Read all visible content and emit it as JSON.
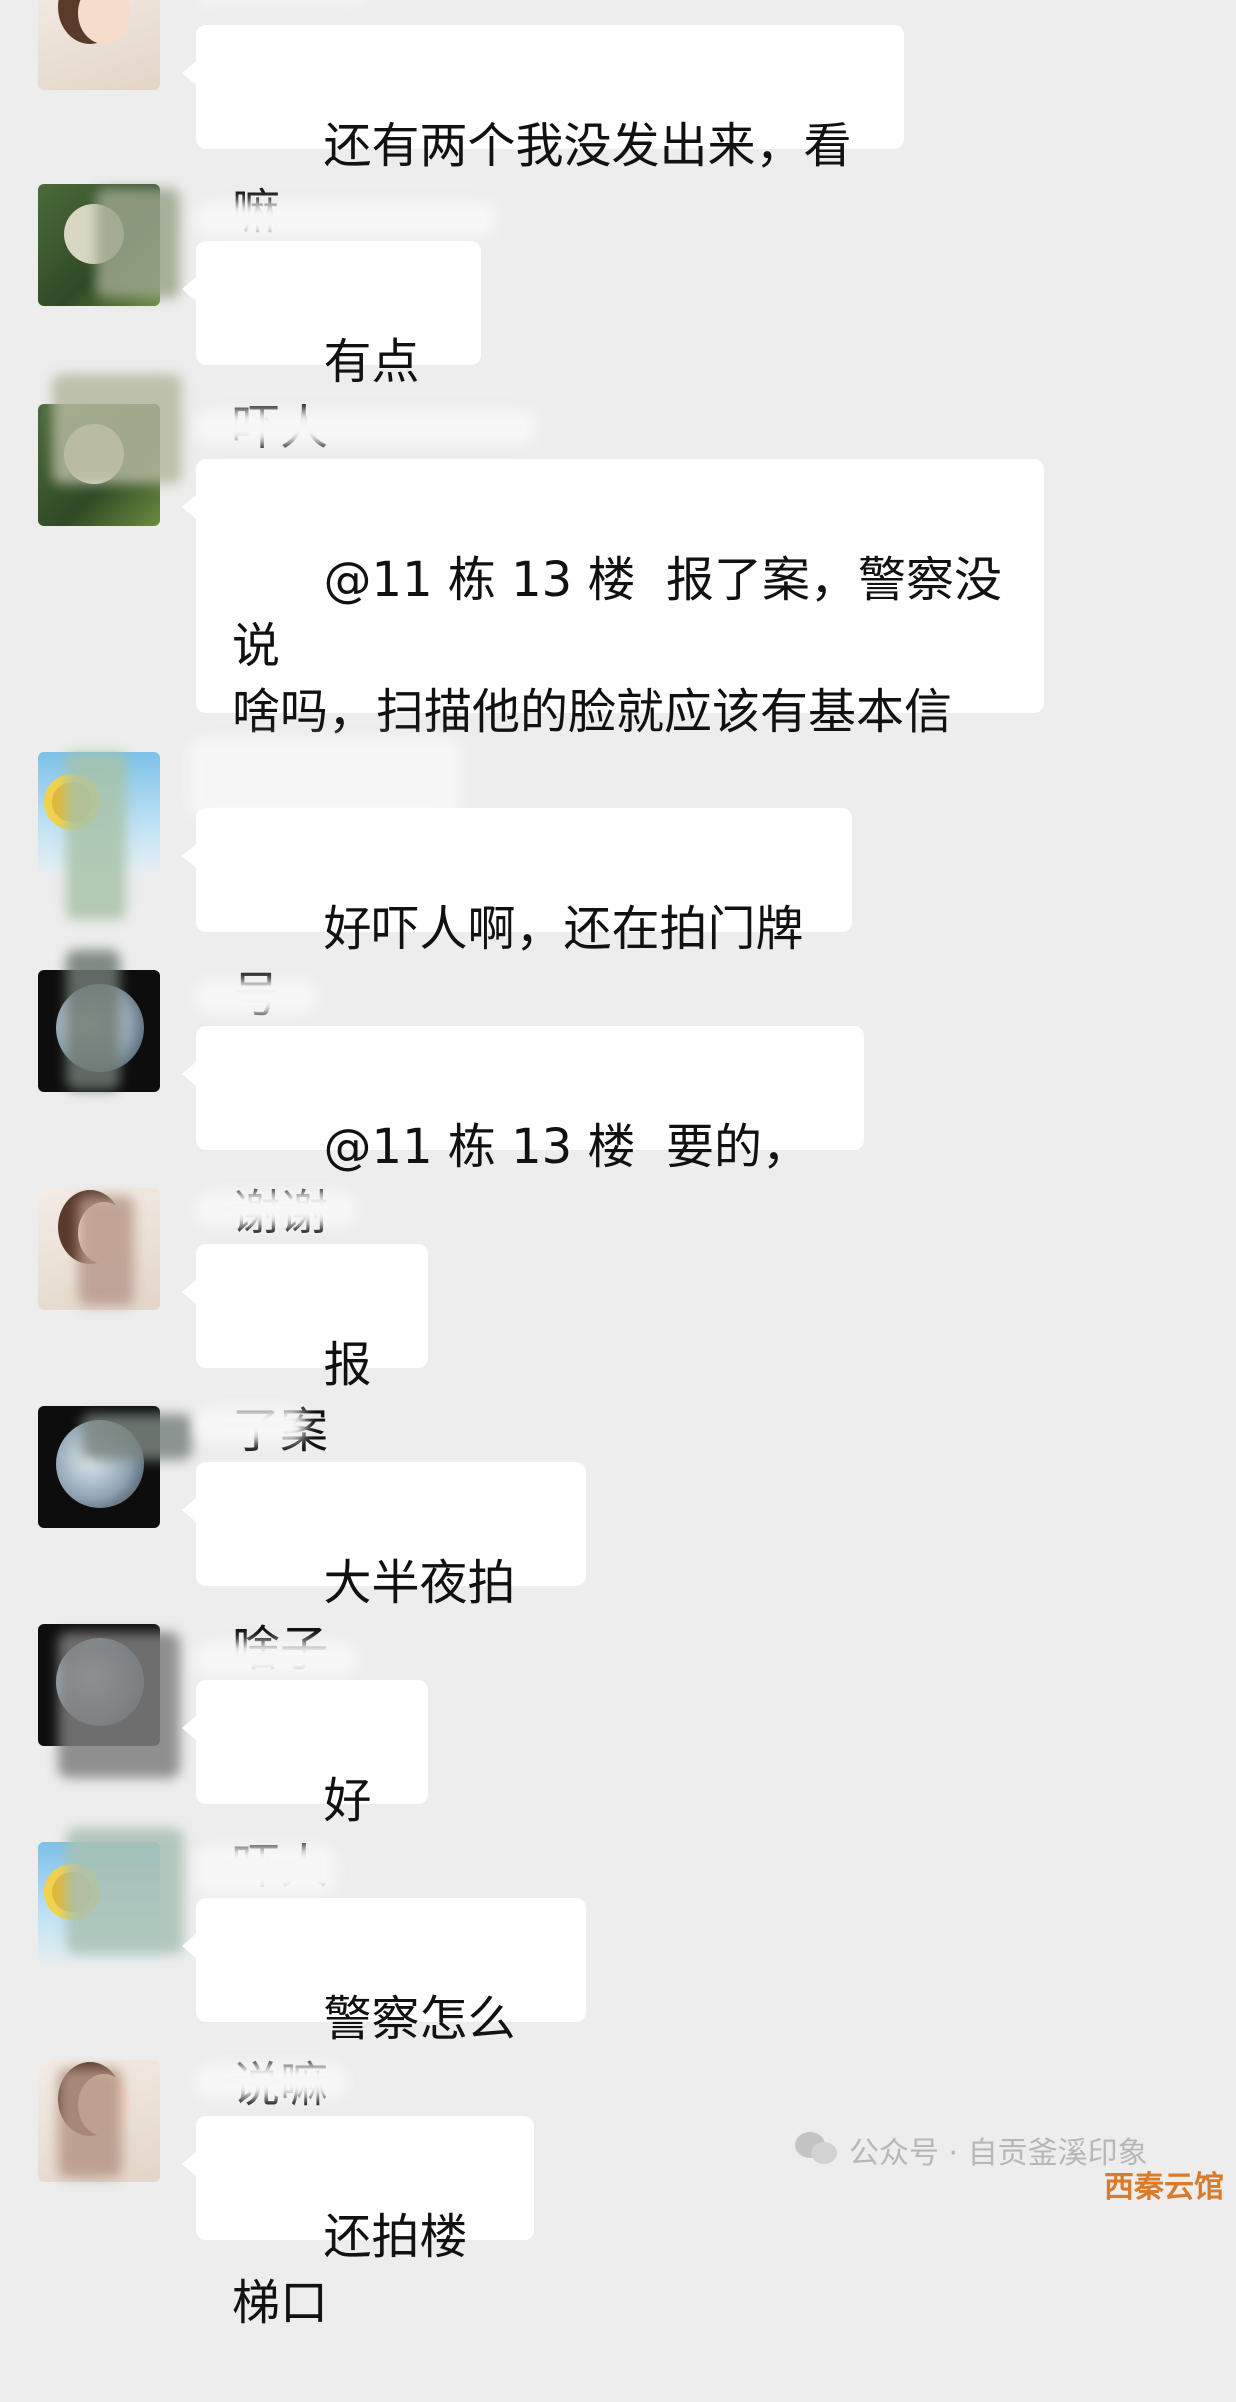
{
  "messages": [
    {
      "avatar": "girl-avatar",
      "text": "还有两个我没发出来，看嘛"
    },
    {
      "avatar": "plant-avatar",
      "text": "有点吓人"
    },
    {
      "avatar": "plant-avatar",
      "text": "@11 栋 13 楼  报了案，警察没说\n啥吗，扫描他的脸就应该有基本信\n息"
    },
    {
      "avatar": "sky-avatar",
      "text": "好吓人啊，还在拍门牌号"
    },
    {
      "avatar": "dark-avatar",
      "text": "@11 栋 13 楼  要的，谢谢"
    },
    {
      "avatar": "girl-avatar",
      "text": "报了案"
    },
    {
      "avatar": "dark-avatar",
      "text": "大半夜拍啥子"
    },
    {
      "avatar": "dark-avatar",
      "text": "好吓人"
    },
    {
      "avatar": "sky-avatar",
      "text": "警察怎么说嘛"
    },
    {
      "avatar": "girl-avatar",
      "text": "还拍楼梯口"
    }
  ],
  "footer": {
    "account_label": "公众号 · 自贡釜溪印象",
    "icon": "wechat-icon"
  },
  "watermark": "西秦云馆"
}
